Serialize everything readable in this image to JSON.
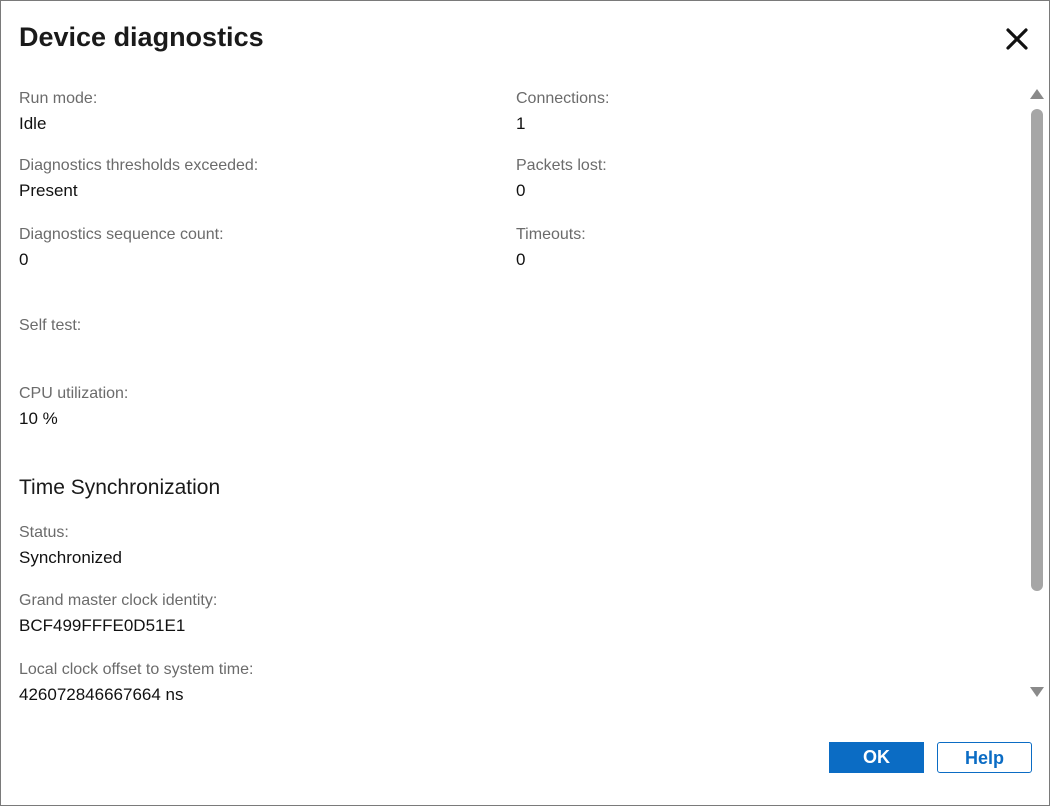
{
  "dialog": {
    "title": "Device diagnostics",
    "close_icon": "close-icon"
  },
  "fields_left": [
    {
      "label": "Run mode:",
      "value": "Idle"
    },
    {
      "label": "Diagnostics thresholds exceeded:",
      "value": "Present"
    },
    {
      "label": "Diagnostics sequence count:",
      "value": "0"
    },
    {
      "label": "Self test:",
      "value": ""
    },
    {
      "label": "CPU utilization:",
      "value": "10  %"
    }
  ],
  "fields_right": [
    {
      "label": "Connections:",
      "value": "1"
    },
    {
      "label": "Packets lost:",
      "value": "0"
    },
    {
      "label": "Timeouts:",
      "value": "0"
    }
  ],
  "time_sync": {
    "heading": "Time Synchronization",
    "fields": [
      {
        "label": "Status:",
        "value": "Synchronized"
      },
      {
        "label": "Grand master clock identity:",
        "value": "BCF499FFFE0D51E1"
      },
      {
        "label": "Local clock offset to system time:",
        "value": "426072846667664  ns"
      }
    ]
  },
  "buttons": {
    "ok_label": "OK",
    "help_label": "Help"
  },
  "colors": {
    "accent": "#0b6cc4",
    "label_text": "#6b6b6b",
    "value_text": "#111111",
    "scroll_thumb": "#a6a6a6"
  }
}
